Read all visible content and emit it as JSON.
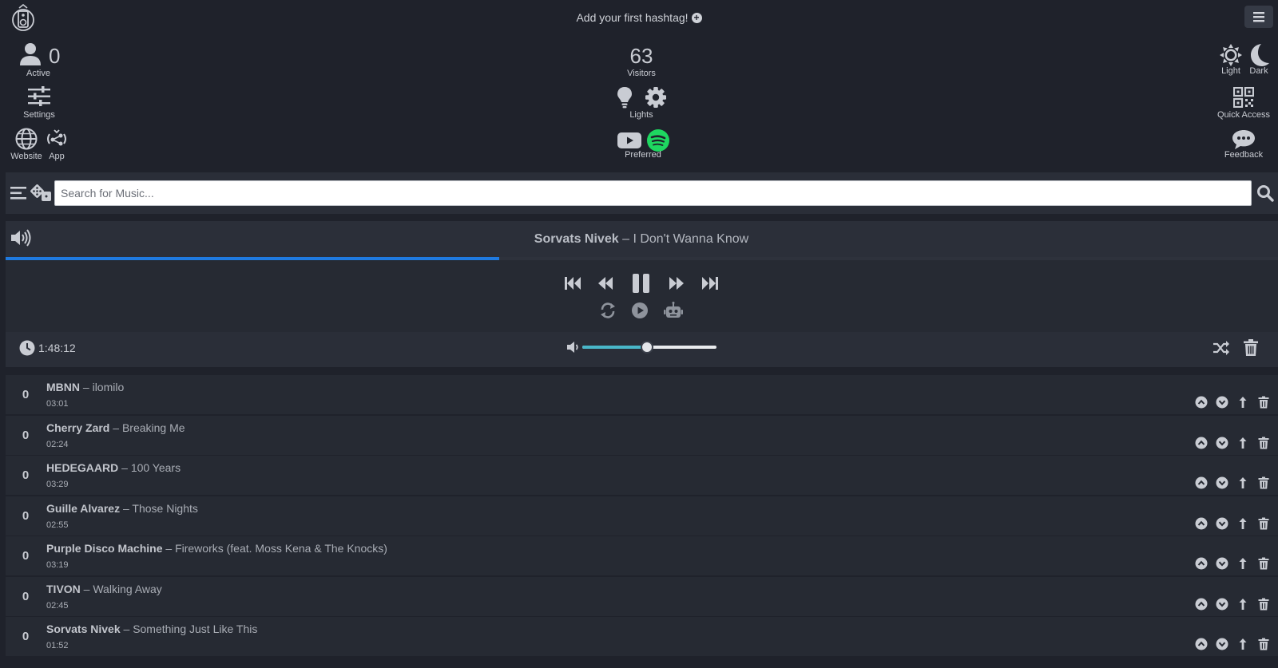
{
  "header": {
    "hashtag_prompt": "Add your first hashtag!"
  },
  "left": {
    "active_count": "0",
    "active_label": "Active",
    "settings_label": "Settings",
    "website_label": "Website",
    "app_label": "App"
  },
  "center": {
    "visitors_count": "63",
    "visitors_label": "Visitors",
    "lights_label": "Lights",
    "preferred_label": "Preferred"
  },
  "right": {
    "light_label": "Light",
    "dark_label": "Dark",
    "quick_access_label": "Quick Access",
    "feedback_label": "Feedback"
  },
  "search": {
    "placeholder": "Search for Music..."
  },
  "player": {
    "artist": "Sorvats Nivek",
    "separator": "–",
    "track": "I Don't Wanna Know",
    "progress": 0.388,
    "total_time": "1:48:12",
    "volume": 0.48
  },
  "colors": {
    "background": "#1f222b",
    "progress": "#1f7ae0",
    "volume": "#49b7c9",
    "spotify": "#1ed760"
  },
  "queue": [
    {
      "votes": "0",
      "artist": "MBNN",
      "title": "ilomilo",
      "duration": "03:01"
    },
    {
      "votes": "0",
      "artist": "Cherry Zard",
      "title": "Breaking Me",
      "duration": "02:24"
    },
    {
      "votes": "0",
      "artist": "HEDEGAARD",
      "title": "100 Years",
      "duration": "03:29"
    },
    {
      "votes": "0",
      "artist": "Guille Alvarez",
      "title": "Those Nights",
      "duration": "02:55"
    },
    {
      "votes": "0",
      "artist": "Purple Disco Machine",
      "title": "Fireworks (feat. Moss Kena & The Knocks)",
      "duration": "03:19"
    },
    {
      "votes": "0",
      "artist": "TIVON",
      "title": "Walking Away",
      "duration": "02:45"
    },
    {
      "votes": "0",
      "artist": "Sorvats Nivek",
      "title": "Something Just Like This",
      "duration": "01:52"
    }
  ]
}
